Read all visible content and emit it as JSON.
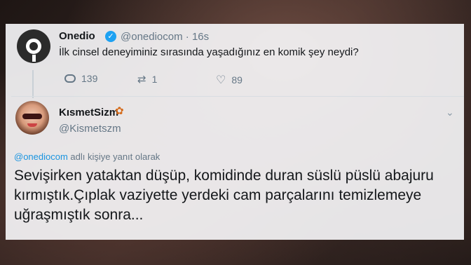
{
  "tweet": {
    "author_name": "Onedio",
    "author_handle": "@onediocom",
    "time": "· 16s",
    "text": "İlk cinsel deneyiminiz sırasında yaşadığınız en komik şey neydi?",
    "replies": "139",
    "retweets": "1",
    "likes": "89"
  },
  "reply": {
    "author_name": "KısmetSizm",
    "author_handle": "@Kismetszm",
    "replying_mention": "@onediocom",
    "replying_text": " adlı kişiye yanıt olarak",
    "text": "Sevişirken yataktan düşüp, komidinde duran süslü püslü abajuru  kırmıştık.Çıplak vaziyette yerdeki cam parçalarını temizlemeye uğraşmıştık sonra..."
  },
  "icons": {
    "verified": "verified-badge-icon",
    "reply": "reply-icon",
    "retweet": "retweet-icon",
    "like": "heart-icon",
    "flower": "bouquet-emoji",
    "chevron": "chevron-down-icon"
  },
  "colors": {
    "accent": "#1da1f2",
    "link": "#1b95e0",
    "muted": "#657786",
    "text": "#14171a"
  }
}
